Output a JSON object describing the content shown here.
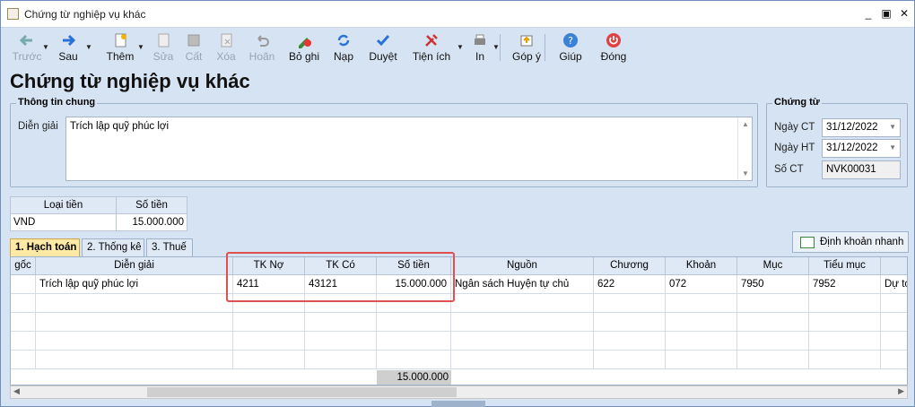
{
  "window": {
    "title": "Chứng từ nghiệp vụ khác"
  },
  "toolbar": {
    "items": [
      {
        "label": "Trước",
        "icon": "arrow-left-icon",
        "enabled": false
      },
      {
        "label": "Sau",
        "icon": "arrow-right-icon",
        "enabled": true
      },
      {
        "label": "Thêm",
        "icon": "new-doc-icon",
        "enabled": true
      },
      {
        "label": "Sửa",
        "icon": "edit-icon",
        "enabled": false
      },
      {
        "label": "Cất",
        "icon": "save-icon",
        "enabled": false
      },
      {
        "label": "Xóa",
        "icon": "delete-icon",
        "enabled": false
      },
      {
        "label": "Hoãn",
        "icon": "undo-icon",
        "enabled": false
      },
      {
        "label": "Bỏ ghi",
        "icon": "unpost-icon",
        "enabled": true
      },
      {
        "label": "Nạp",
        "icon": "refresh-icon",
        "enabled": true
      },
      {
        "label": "Duyệt",
        "icon": "check-icon",
        "enabled": true
      },
      {
        "label": "Tiện ích",
        "icon": "tools-icon",
        "enabled": true
      },
      {
        "label": "In",
        "icon": "print-icon",
        "enabled": true
      },
      {
        "label": "Góp ý",
        "icon": "feedback-icon",
        "enabled": true
      },
      {
        "label": "Giúp",
        "icon": "help-icon",
        "enabled": true
      },
      {
        "label": "Đóng",
        "icon": "power-icon",
        "enabled": true
      }
    ]
  },
  "page": {
    "title": "Chứng từ nghiệp vụ khác"
  },
  "general": {
    "legend": "Thông tin chung",
    "desc_label": "Diễn giải",
    "desc_value": "Trích lập quỹ phúc lợi"
  },
  "voucher": {
    "legend": "Chứng từ",
    "date_ct_label": "Ngày CT",
    "date_ct": "31/12/2022",
    "date_ht_label": "Ngày HT",
    "date_ht": "31/12/2022",
    "no_label": "Số CT",
    "no": "NVK00031"
  },
  "currency": {
    "h_type": "Loại tiền",
    "h_amount": "Số tiền",
    "type": "VND",
    "amount": "15.000.000"
  },
  "tabs": [
    {
      "label": "1. Hạch toán",
      "active": true
    },
    {
      "label": "2. Thống kê",
      "active": false
    },
    {
      "label": "3. Thuế",
      "active": false
    }
  ],
  "quick_button": {
    "label": "Định khoản nhanh"
  },
  "grid": {
    "headers": [
      "gốc",
      "Diễn giải",
      "TK Nợ",
      "TK Có",
      "Số tiền",
      "Nguồn",
      "Chương",
      "Khoản",
      "Mục",
      "Tiểu mục",
      ""
    ],
    "rows": [
      [
        "",
        "Trích lập quỹ phúc lợi",
        "4211",
        "43121",
        "15.000.000",
        "Ngân sách Huyện tự chủ",
        "622",
        "072",
        "7950",
        "7952",
        "Dự to"
      ]
    ],
    "total": "15.000.000"
  },
  "colors": {
    "accent": "#d6e3f3",
    "highlight": "#e05050",
    "active_tab": "#ffe9a4"
  }
}
